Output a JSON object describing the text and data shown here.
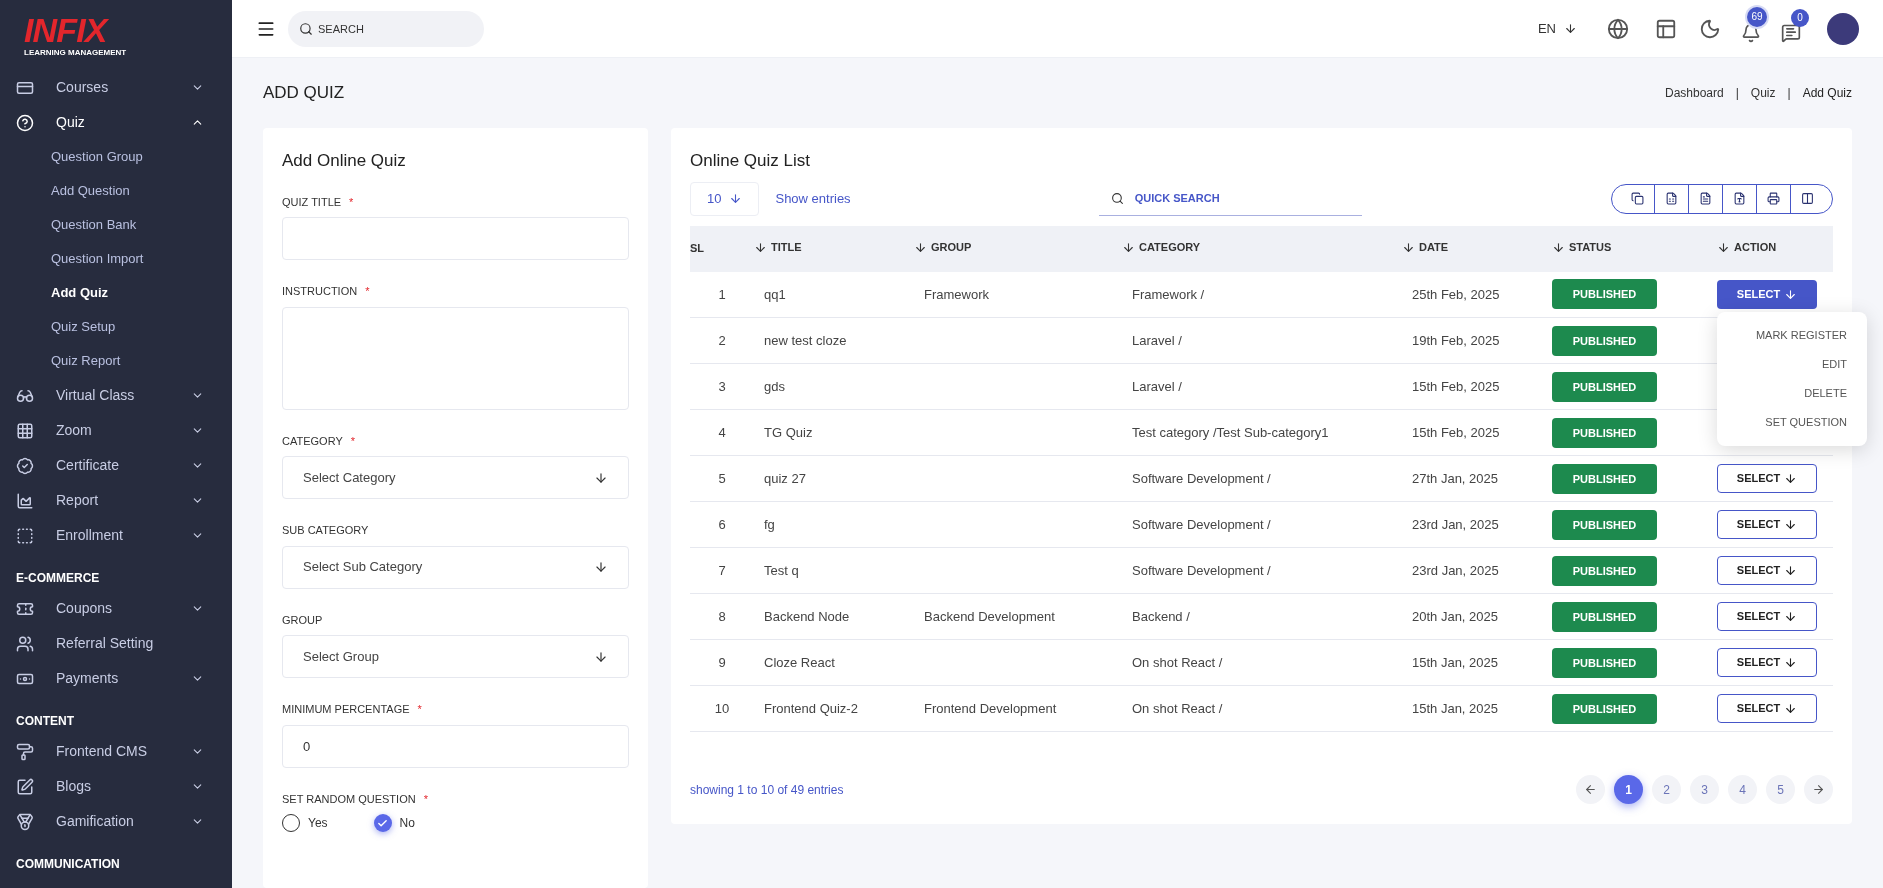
{
  "sidebar": {
    "logo": {
      "text": "INFIX",
      "subtitle": "LEARNING MANAGEMENT"
    },
    "sections": [
      {
        "items": [
          {
            "label": "Courses",
            "expanded": false
          },
          {
            "label": "Quiz",
            "expanded": true,
            "children": [
              {
                "label": "Question Group",
                "selected": false
              },
              {
                "label": "Add Question",
                "selected": false
              },
              {
                "label": "Question Bank",
                "selected": false
              },
              {
                "label": "Question Import",
                "selected": false
              },
              {
                "label": "Add Quiz",
                "selected": true
              },
              {
                "label": "Quiz Setup",
                "selected": false
              },
              {
                "label": "Quiz Report",
                "selected": false
              }
            ]
          },
          {
            "label": "Virtual Class",
            "expanded": false
          },
          {
            "label": "Zoom",
            "expanded": false
          },
          {
            "label": "Certificate",
            "expanded": false
          },
          {
            "label": "Report",
            "expanded": false
          },
          {
            "label": "Enrollment",
            "expanded": false
          }
        ]
      },
      {
        "heading": "E-COMMERCE",
        "items": [
          {
            "label": "Coupons",
            "expanded": false
          },
          {
            "label": "Referral Setting"
          },
          {
            "label": "Payments",
            "expanded": false
          }
        ]
      },
      {
        "heading": "CONTENT",
        "items": [
          {
            "label": "Frontend CMS",
            "expanded": false
          },
          {
            "label": "Blogs",
            "expanded": false
          },
          {
            "label": "Gamification",
            "expanded": false
          }
        ]
      },
      {
        "heading": "COMMUNICATION"
      }
    ]
  },
  "topbar": {
    "search": {
      "placeholder": "SEARCH"
    },
    "language": "EN",
    "notifications": "69",
    "messages": "0"
  },
  "page": {
    "title": "ADD QUIZ",
    "breadcrumb": [
      {
        "kind": "link",
        "text": "Dashboard"
      },
      {
        "kind": "separator",
        "text": "|"
      },
      {
        "kind": "link",
        "text": "Quiz"
      },
      {
        "kind": "separator",
        "text": "|"
      },
      {
        "kind": "current",
        "text": "Add Quiz"
      }
    ]
  },
  "form": {
    "title": "Add Online Quiz",
    "fields": [
      {
        "kind": "text",
        "label": "QUIZ TITLE",
        "required_mark": "*"
      },
      {
        "kind": "textarea",
        "label": "INSTRUCTION",
        "required_mark": "*"
      },
      {
        "kind": "select",
        "label": "CATEGORY",
        "required_mark": "*",
        "placeholder": "Select Category"
      },
      {
        "kind": "select",
        "label": "SUB CATEGORY",
        "placeholder": "Select Sub Category"
      },
      {
        "kind": "select",
        "label": "GROUP",
        "placeholder": "Select Group"
      },
      {
        "kind": "text",
        "label": "MINIMUM PERCENTAGE",
        "required_mark": "*",
        "value": "0"
      },
      {
        "kind": "radio",
        "label": "SET RANDOM QUESTION",
        "required_mark": "*",
        "options": [
          {
            "label": "Yes",
            "selected": false
          },
          {
            "label": "No",
            "selected": true
          }
        ]
      }
    ]
  },
  "quiz_list": {
    "title": "Online Quiz List",
    "page_size": "10",
    "show_entries": "Show entries",
    "search": {
      "placeholder": "QUICK SEARCH"
    },
    "columns": [
      {
        "label": "SL",
        "sortable": false
      },
      {
        "label": "TITLE",
        "sortable": true
      },
      {
        "label": "GROUP",
        "sortable": true
      },
      {
        "label": "CATEGORY",
        "sortable": true
      },
      {
        "label": "DATE",
        "sortable": true
      },
      {
        "label": "STATUS",
        "sortable": true
      },
      {
        "label": "ACTION",
        "sortable": true
      }
    ],
    "rows": [
      {
        "sl": "1",
        "title": "qq1",
        "group": "Framework",
        "category": "Framework /",
        "date": "25th Feb, 2025",
        "status": "PUBLISHED",
        "action": "SELECT",
        "open": true
      },
      {
        "sl": "2",
        "title": "new test cloze",
        "category": "Laravel /",
        "date": "19th Feb, 2025",
        "status": "PUBLISHED"
      },
      {
        "sl": "3",
        "title": "gds",
        "category": "Laravel /",
        "date": "15th Feb, 2025",
        "status": "PUBLISHED"
      },
      {
        "sl": "4",
        "title": "TG Quiz",
        "category": "Test category /Test Sub-category1",
        "date": "15th Feb, 2025",
        "status": "PUBLISHED"
      },
      {
        "sl": "5",
        "title": "quiz 27",
        "group": "",
        "category": "Software Development /",
        "date": "27th Jan, 2025",
        "status": "PUBLISHED",
        "action": "SELECT",
        "open": false
      },
      {
        "sl": "6",
        "title": "fg",
        "group": "",
        "category": "Software Development /",
        "date": "23rd Jan, 2025",
        "status": "PUBLISHED",
        "action": "SELECT",
        "open": false
      },
      {
        "sl": "7",
        "title": "Test q",
        "group": "",
        "category": "Software Development /",
        "date": "23rd Jan, 2025",
        "status": "PUBLISHED",
        "action": "SELECT",
        "open": false
      },
      {
        "sl": "8",
        "title": "Backend Node",
        "group": "Backend Development",
        "category": "Backend /",
        "date": "20th Jan, 2025",
        "status": "PUBLISHED",
        "action": "SELECT",
        "open": false
      },
      {
        "sl": "9",
        "title": "Cloze React",
        "group": "",
        "category": "On shot React /",
        "date": "15th Jan, 2025",
        "status": "PUBLISHED",
        "action": "SELECT",
        "open": false
      },
      {
        "sl": "10",
        "title": "Frontend Quiz-2",
        "group": "Frontend Development",
        "category": "On shot React /",
        "date": "15th Jan, 2025",
        "status": "PUBLISHED",
        "action": "SELECT",
        "open": false
      }
    ],
    "action_menu": [
      "MARK REGISTER",
      "EDIT",
      "DELETE",
      "SET QUESTION"
    ],
    "summary": "showing 1 to 10 of 49 entries",
    "pages": [
      {
        "label": "1",
        "selected": true
      },
      {
        "label": "2",
        "selected": false
      },
      {
        "label": "3",
        "selected": false
      },
      {
        "label": "4",
        "selected": false
      },
      {
        "label": "5",
        "selected": false
      }
    ]
  }
}
